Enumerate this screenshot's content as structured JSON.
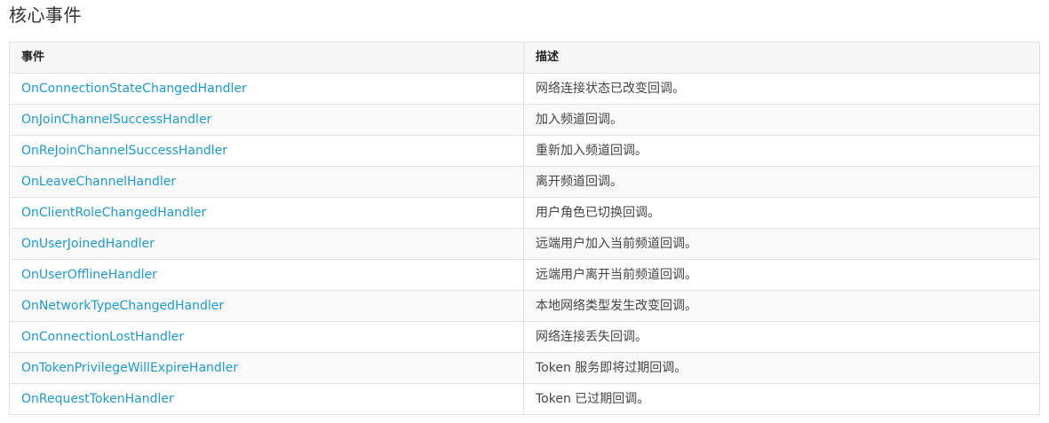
{
  "section": {
    "title": "核心事件"
  },
  "table": {
    "headers": {
      "event": "事件",
      "description": "描述"
    },
    "rows": [
      {
        "event": "OnConnectionStateChangedHandler",
        "description": "网络连接状态已改变回调。"
      },
      {
        "event": "OnJoinChannelSuccessHandler",
        "description": "加入频道回调。"
      },
      {
        "event": "OnReJoinChannelSuccessHandler",
        "description": "重新加入频道回调。"
      },
      {
        "event": "OnLeaveChannelHandler",
        "description": "离开频道回调。"
      },
      {
        "event": "OnClientRoleChangedHandler",
        "description": "用户角色已切换回调。"
      },
      {
        "event": "OnUserJoinedHandler",
        "description": "远端用户加入当前频道回调。"
      },
      {
        "event": "OnUserOfflineHandler",
        "description": "远端用户离开当前频道回调。"
      },
      {
        "event": "OnNetworkTypeChangedHandler",
        "description": "本地网络类型发生改变回调。"
      },
      {
        "event": "OnConnectionLostHandler",
        "description": "网络连接丢失回调。"
      },
      {
        "event": "OnTokenPrivilegeWillExpireHandler",
        "description": "Token 服务即将过期回调。"
      },
      {
        "event": "OnRequestTokenHandler",
        "description": "Token 已过期回调。"
      }
    ]
  },
  "colors": {
    "link": "#1a9ad6",
    "header_bg": "#f6f6f6",
    "stripe_bg": "#f9f9f9",
    "border": "#e3e3e3"
  }
}
